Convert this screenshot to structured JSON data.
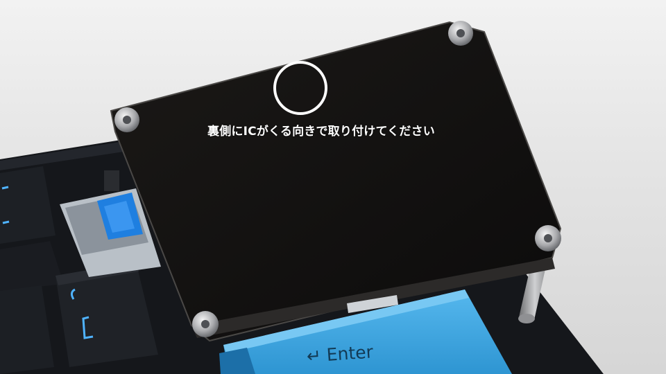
{
  "annotation": {
    "caption": "裏側にICがくる向きで取り付けてください",
    "marker_shape": "circle",
    "marker_color": "#ffffff"
  },
  "photo": {
    "subject": "black acrylic cover plate mounted on a keyboard with standoffs",
    "key_label": "Enter",
    "key_arrow": "↵",
    "colors": {
      "background": "#e8e8e8",
      "plate": "#141211",
      "keycap_blue": "#3aa7e4",
      "switch_blue": "#1f7fe0",
      "keycap_dark": "#1b1d22",
      "legend_glow": "#4fb3ff"
    }
  }
}
